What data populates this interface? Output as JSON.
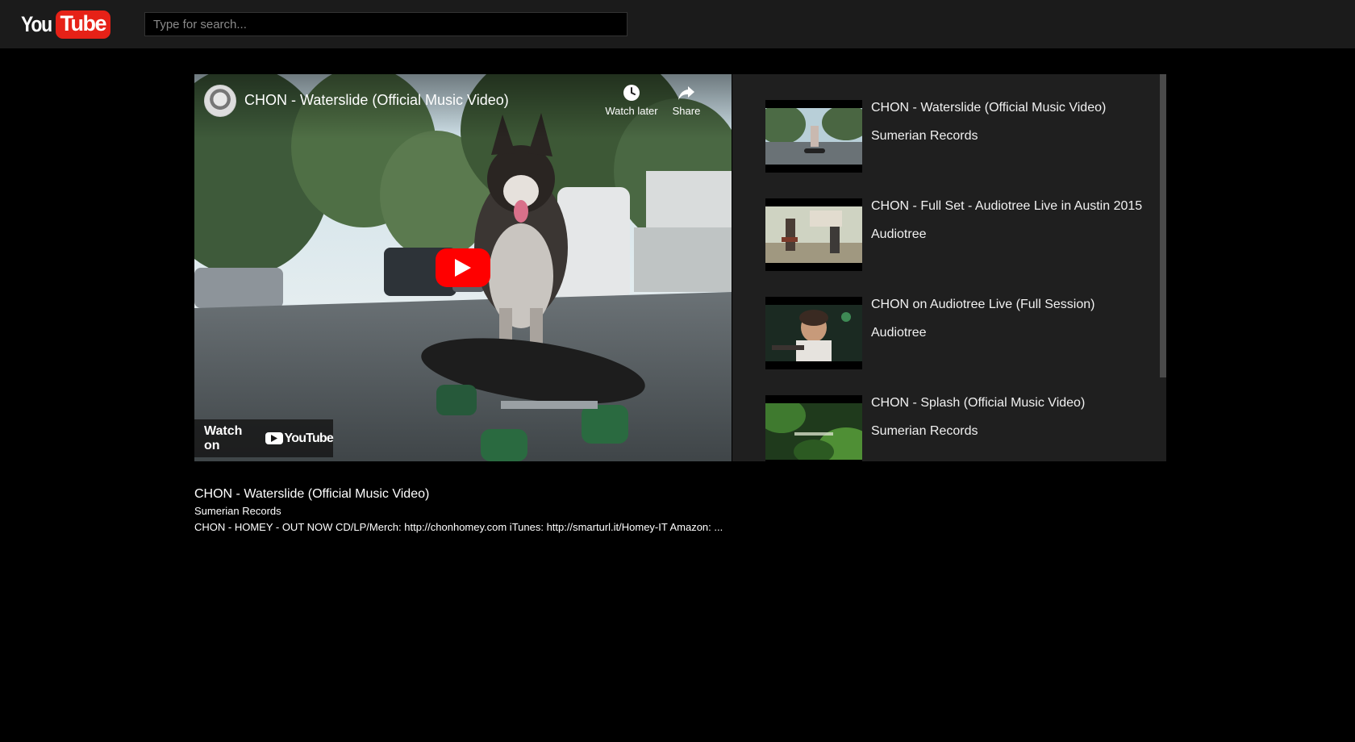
{
  "header": {
    "logo_you": "You",
    "logo_tube": "Tube",
    "search_placeholder": "Type for search..."
  },
  "player": {
    "title": "CHON - Waterslide (Official Music Video)",
    "watch_later_label": "Watch later",
    "share_label": "Share",
    "watch_on_label": "Watch on",
    "watch_on_brand": "YouTube",
    "icons": [
      "channel-avatar",
      "clock-icon",
      "share-arrow-icon",
      "play-icon",
      "youtube-logo-icon"
    ],
    "colors": {
      "play_button": "#ff0000"
    }
  },
  "related": {
    "items": [
      {
        "title": "CHON - Waterslide (Official Music Video)",
        "channel": "Sumerian Records"
      },
      {
        "title": "CHON - Full Set - Audiotree Live in Austin 2015",
        "channel": "Audiotree"
      },
      {
        "title": "CHON on Audiotree Live (Full Session)",
        "channel": "Audiotree"
      },
      {
        "title": "CHON - Splash (Official Music Video)",
        "channel": "Sumerian Records"
      }
    ]
  },
  "info": {
    "title": "CHON - Waterslide (Official Music Video)",
    "channel": "Sumerian Records",
    "description": "CHON - HOMEY - OUT NOW CD/LP/Merch: http://chonhomey.com iTunes: http://smarturl.it/Homey-IT Amazon: ..."
  },
  "colors": {
    "header_bg": "#1b1b1b",
    "page_bg": "#000000",
    "sidebar_bg": "#1f1f1f",
    "logo_red": "#e62117"
  }
}
